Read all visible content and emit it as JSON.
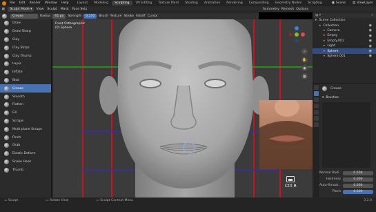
{
  "menubar": {
    "items": [
      "File",
      "Edit",
      "Render",
      "Window",
      "Help"
    ],
    "workspaces": [
      "Layout",
      "Modeling",
      "Sculpting",
      "UV Editing",
      "Texture Paint",
      "Shading",
      "Animation",
      "Rendering",
      "Compositing",
      "Geometry Nodes",
      "Scripting"
    ],
    "active_workspace": "Sculpting",
    "scene": "Scene",
    "view_layer": "ViewLayer"
  },
  "header": {
    "mode": "Sculpt Mode",
    "menus": [
      "View",
      "Sculpt",
      "Mask",
      "Face Sets"
    ],
    "symmetry": "Symmetry",
    "remesh": "Remesh",
    "options": "Options"
  },
  "toolsettings": {
    "brush": "Crease",
    "radius_label": "Radius",
    "radius_value": "61 px",
    "strength_label": "Strength",
    "strength_value": "0.250",
    "brush_menu": "Brush",
    "texture_menu": "Texture",
    "stroke_menu": "Stroke",
    "falloff_menu": "Falloff",
    "cursor_menu": "Cursor"
  },
  "tools": [
    {
      "label": "Draw"
    },
    {
      "label": "Draw Sharp"
    },
    {
      "label": "Clay"
    },
    {
      "label": "Clay Strips"
    },
    {
      "label": "Clay Thumb"
    },
    {
      "label": "Layer"
    },
    {
      "label": "Inflate"
    },
    {
      "label": "Blob"
    },
    {
      "label": "Crease",
      "active": true
    },
    {
      "label": "Smooth"
    },
    {
      "label": "Flatten"
    },
    {
      "label": "Fill"
    },
    {
      "label": "Scrape"
    },
    {
      "label": "Multi-plane Scrape"
    },
    {
      "label": "Pinch"
    },
    {
      "label": "Grab"
    },
    {
      "label": "Elastic Deform"
    },
    {
      "label": "Snake Hook"
    },
    {
      "label": "Thumb"
    }
  ],
  "viewport": {
    "view_name": "Front Orthographic",
    "object_name": "(0) Sphere"
  },
  "gizmo": {
    "x": "X",
    "y": "Y",
    "z": "Z"
  },
  "outliner": {
    "items": [
      {
        "label": "Scene Collection",
        "indent": 0
      },
      {
        "label": "Collection",
        "indent": 1
      },
      {
        "label": "Camera",
        "indent": 2
      },
      {
        "label": "Empty",
        "indent": 2
      },
      {
        "label": "Empty.001",
        "indent": 2
      },
      {
        "label": "Light",
        "indent": 2
      },
      {
        "label": "Sphere",
        "indent": 2,
        "selected": true
      },
      {
        "label": "Sphere.001",
        "indent": 2
      }
    ]
  },
  "properties": {
    "brush_name": "Crease",
    "brushes_panel": "Brushes",
    "rows": [
      {
        "label": "Normal Radi...",
        "value": "0.500"
      },
      {
        "label": "Hardness",
        "value": "0.000"
      },
      {
        "label": "Auto-Smoot...",
        "value": "0.000"
      },
      {
        "label": "Pinch",
        "value": "0.500",
        "highlight": true
      }
    ]
  },
  "keypress": {
    "label": "Ctrl R"
  },
  "statusbar": {
    "items": [
      "Sculpt",
      "Rotate View",
      "Sculpt Context Menu"
    ],
    "version": "3.2.0"
  },
  "colors": {
    "accent": "#4772b3",
    "orange": "#e87d0d",
    "mesh_guide_red": "#d01020",
    "mesh_guide_green": "#2b8a1e",
    "mesh_guide_blue": "#3a2e9e",
    "axis_x": "#e34850",
    "axis_y": "#7fbf1f",
    "axis_z": "#3f7fe0"
  }
}
